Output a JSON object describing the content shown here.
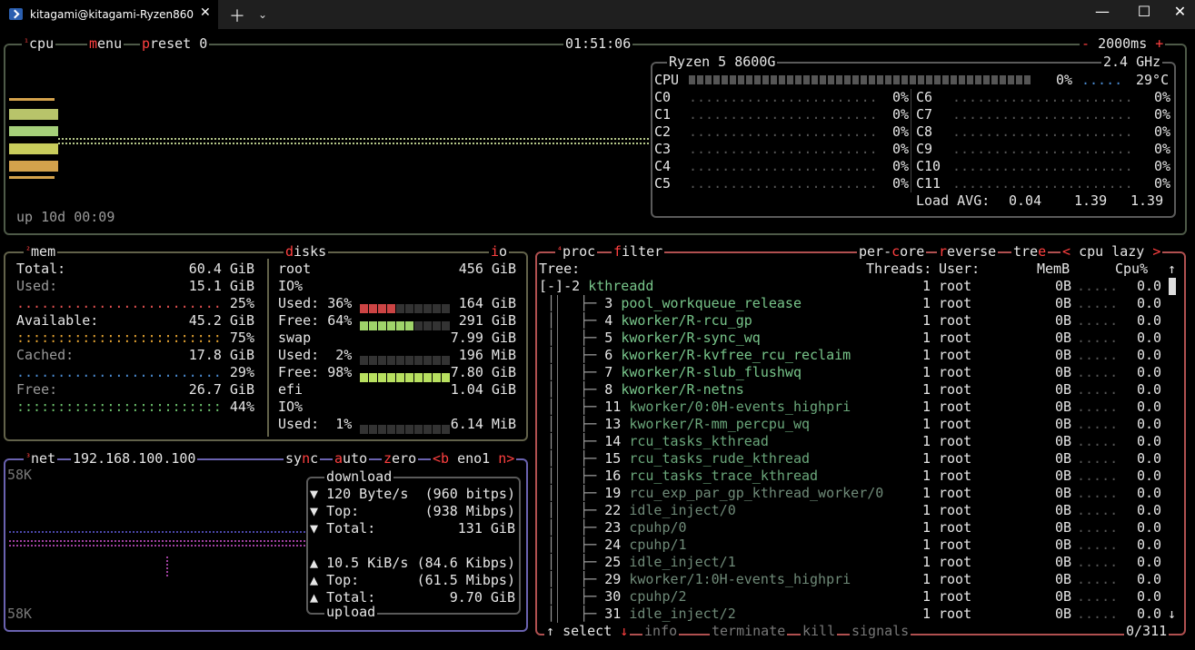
{
  "window": {
    "tab_title": "kitagami@kitagami-Ryzen860"
  },
  "cpu": {
    "title": "cpu",
    "menu": "menu",
    "preset": "preset 0",
    "clock": "01:51:06",
    "minus": "-",
    "interval": "2000ms",
    "plus": "+",
    "uptime": "up 10d 00:09",
    "model": "Ryzen 5 8600G",
    "freq": "2.4 GHz",
    "total_label": "CPU",
    "total_pct": "0%",
    "temp": "29°C",
    "cores_left": [
      {
        "name": "C0",
        "pct": "0%"
      },
      {
        "name": "C1",
        "pct": "0%"
      },
      {
        "name": "C2",
        "pct": "0%"
      },
      {
        "name": "C3",
        "pct": "0%"
      },
      {
        "name": "C4",
        "pct": "0%"
      },
      {
        "name": "C5",
        "pct": "0%"
      }
    ],
    "cores_right": [
      {
        "name": "C6",
        "pct": "0%"
      },
      {
        "name": "C7",
        "pct": "0%"
      },
      {
        "name": "C8",
        "pct": "0%"
      },
      {
        "name": "C9",
        "pct": "0%"
      },
      {
        "name": "C10",
        "pct": "0%"
      },
      {
        "name": "C11",
        "pct": "0%"
      }
    ],
    "load_label": "Load AVG:",
    "load": [
      "0.04",
      "1.39",
      "1.39"
    ]
  },
  "mem": {
    "title": "mem",
    "total_label": "Total:",
    "total": "60.4 GiB",
    "used_label": "Used:",
    "used": "15.1 GiB",
    "used_pct": "25%",
    "avail_label": "Available:",
    "avail": "45.2 GiB",
    "avail_pct": "75%",
    "cached_label": "Cached:",
    "cached": "17.8 GiB",
    "cached_pct": "29%",
    "free_label": "Free:",
    "free": "26.7 GiB",
    "free_pct": "44%",
    "colors": {
      "used": "#e05050",
      "avail": "#e0a030",
      "cached": "#4a8ad0",
      "free": "#6cc06c"
    }
  },
  "disks": {
    "title": "disks",
    "io_tab": "io",
    "items": [
      {
        "name": "root",
        "size": "456 GiB",
        "io": "IO%",
        "used_label": "Used:",
        "used_pct": "36%",
        "used": "164 GiB",
        "free_label": "Free:",
        "free_pct": "64%",
        "free": "291 GiB",
        "used_frac": 0.36,
        "free_frac": 0.64
      },
      {
        "name": "swap",
        "size": "7.99 GiB",
        "used_label": "Used:",
        "used_pct": "2%",
        "used": "196 MiB",
        "free_label": "Free:",
        "free_pct": "98%",
        "free": "7.80 GiB",
        "used_frac": 0.02,
        "free_frac": 0.98
      },
      {
        "name": "efi",
        "size": "1.04 GiB",
        "io": "IO%",
        "used_label": "Used:",
        "used_pct": "1%",
        "used": "6.14 MiB",
        "used_frac": 0.01
      }
    ]
  },
  "net": {
    "title": "net",
    "ip": "192.168.100.100",
    "sync": "sync",
    "auto": "auto",
    "zero": "zero",
    "b_key": "<b",
    "iface": "eno1",
    "n_key": "n>",
    "scale_top": "58K",
    "scale_bottom": "58K",
    "download_label": "download",
    "upload_label": "upload",
    "down": {
      "rate": "120 Byte/s",
      "rate_bits": "(960 bitps)",
      "top_label": "Top:",
      "top": "(938 Mibps)",
      "total_label": "Total:",
      "total": "131 GiB"
    },
    "up": {
      "rate": "10.5 KiB/s",
      "rate_bits": "(84.6 Kibps)",
      "top_label": "Top:",
      "top": "(61.5 Mibps)",
      "total_label": "Total:",
      "total": "9.70 GiB"
    }
  },
  "proc": {
    "title": "proc",
    "filter": "filter",
    "per_core": "per-core",
    "reverse": "reverse",
    "tree": "tree",
    "sort_left": "<",
    "sort": "cpu lazy",
    "sort_right": ">",
    "headers": {
      "tree": "Tree:",
      "threads": "Threads:",
      "user": "User:",
      "mem": "MemB",
      "cpu": "Cpu%"
    },
    "root": {
      "toggle": "[-]-",
      "pid": "2",
      "name": "kthreadd",
      "threads": "1",
      "user": "root",
      "mem": "0B",
      "cpu": "0.0"
    },
    "rows": [
      {
        "pid": "3",
        "name": "pool_workqueue_release",
        "threads": "1",
        "user": "root",
        "mem": "0B",
        "cpu": "0.0"
      },
      {
        "pid": "4",
        "name": "kworker/R-rcu_gp",
        "threads": "1",
        "user": "root",
        "mem": "0B",
        "cpu": "0.0"
      },
      {
        "pid": "5",
        "name": "kworker/R-sync_wq",
        "threads": "1",
        "user": "root",
        "mem": "0B",
        "cpu": "0.0"
      },
      {
        "pid": "6",
        "name": "kworker/R-kvfree_rcu_reclaim",
        "threads": "1",
        "user": "root",
        "mem": "0B",
        "cpu": "0.0"
      },
      {
        "pid": "7",
        "name": "kworker/R-slub_flushwq",
        "threads": "1",
        "user": "root",
        "mem": "0B",
        "cpu": "0.0"
      },
      {
        "pid": "8",
        "name": "kworker/R-netns",
        "threads": "1",
        "user": "root",
        "mem": "0B",
        "cpu": "0.0"
      },
      {
        "pid": "11",
        "name": "kworker/0:0H-events_highpri",
        "threads": "1",
        "user": "root",
        "mem": "0B",
        "cpu": "0.0"
      },
      {
        "pid": "13",
        "name": "kworker/R-mm_percpu_wq",
        "threads": "1",
        "user": "root",
        "mem": "0B",
        "cpu": "0.0"
      },
      {
        "pid": "14",
        "name": "rcu_tasks_kthread",
        "threads": "1",
        "user": "root",
        "mem": "0B",
        "cpu": "0.0"
      },
      {
        "pid": "15",
        "name": "rcu_tasks_rude_kthread",
        "threads": "1",
        "user": "root",
        "mem": "0B",
        "cpu": "0.0"
      },
      {
        "pid": "16",
        "name": "rcu_tasks_trace_kthread",
        "threads": "1",
        "user": "root",
        "mem": "0B",
        "cpu": "0.0"
      },
      {
        "pid": "19",
        "name": "rcu_exp_par_gp_kthread_worker/0",
        "threads": "1",
        "user": "root",
        "mem": "0B",
        "cpu": "0.0"
      },
      {
        "pid": "22",
        "name": "idle_inject/0",
        "threads": "1",
        "user": "root",
        "mem": "0B",
        "cpu": "0.0"
      },
      {
        "pid": "23",
        "name": "cpuhp/0",
        "threads": "1",
        "user": "root",
        "mem": "0B",
        "cpu": "0.0"
      },
      {
        "pid": "24",
        "name": "cpuhp/1",
        "threads": "1",
        "user": "root",
        "mem": "0B",
        "cpu": "0.0"
      },
      {
        "pid": "25",
        "name": "idle_inject/1",
        "threads": "1",
        "user": "root",
        "mem": "0B",
        "cpu": "0.0"
      },
      {
        "pid": "29",
        "name": "kworker/1:0H-events_highpri",
        "threads": "1",
        "user": "root",
        "mem": "0B",
        "cpu": "0.0"
      },
      {
        "pid": "30",
        "name": "cpuhp/2",
        "threads": "1",
        "user": "root",
        "mem": "0B",
        "cpu": "0.0"
      },
      {
        "pid": "31",
        "name": "idle_inject/2",
        "threads": "1",
        "user": "root",
        "mem": "0B",
        "cpu": "0.0"
      }
    ],
    "footer": {
      "up": "↑",
      "select": "select",
      "down": "↓",
      "info": "info",
      "terminate": "terminate",
      "kill": "kill",
      "signals": "signals",
      "count": "0/311"
    }
  }
}
